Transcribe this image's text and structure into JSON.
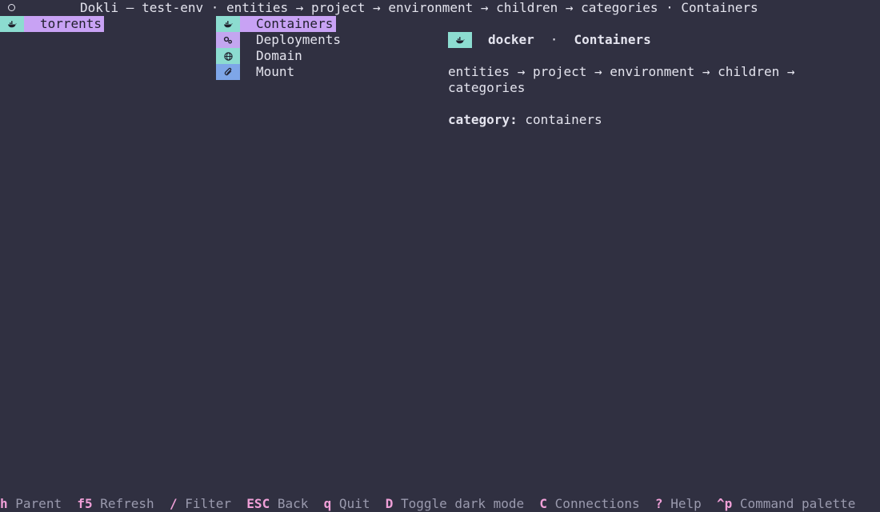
{
  "header": {
    "title": "Dokli — test-env · entities → project → environment → children → categories · Containers"
  },
  "left_pane": {
    "items": [
      {
        "label": "torrents",
        "icon": "docker-whale-icon",
        "selected": true
      }
    ]
  },
  "middle_pane": {
    "items": [
      {
        "label": "Containers",
        "icon": "docker-whale-icon",
        "selected": true
      },
      {
        "label": "Deployments",
        "icon": "gears-icon",
        "selected": false
      },
      {
        "label": "Domain",
        "icon": "globe-icon",
        "selected": false
      },
      {
        "label": "Mount",
        "icon": "paperclip-icon",
        "selected": false
      }
    ]
  },
  "detail": {
    "provider": "docker",
    "separator": "·",
    "title": "Containers",
    "path": "entities → project → environment → children → categories",
    "category_label": "category:",
    "category_value": "containers"
  },
  "footer": {
    "bindings": [
      {
        "key": "h",
        "label": "Parent"
      },
      {
        "key": "f5",
        "label": "Refresh"
      },
      {
        "key": "/",
        "label": "Filter"
      },
      {
        "key": "ESC",
        "label": "Back"
      },
      {
        "key": "q",
        "label": "Quit"
      },
      {
        "key": "D",
        "label": "Toggle dark mode"
      },
      {
        "key": "C",
        "label": "Connections"
      },
      {
        "key": "?",
        "label": "Help"
      },
      {
        "key": "^p",
        "label": "Command palette"
      }
    ]
  },
  "colors": {
    "background": "#303041",
    "selection": "#c8a2f4",
    "icon_teal": "#8cdcd0",
    "icon_lilac": "#c3a6f0",
    "icon_blue": "#7ea6e8",
    "key_accent": "#f0a0d8"
  }
}
